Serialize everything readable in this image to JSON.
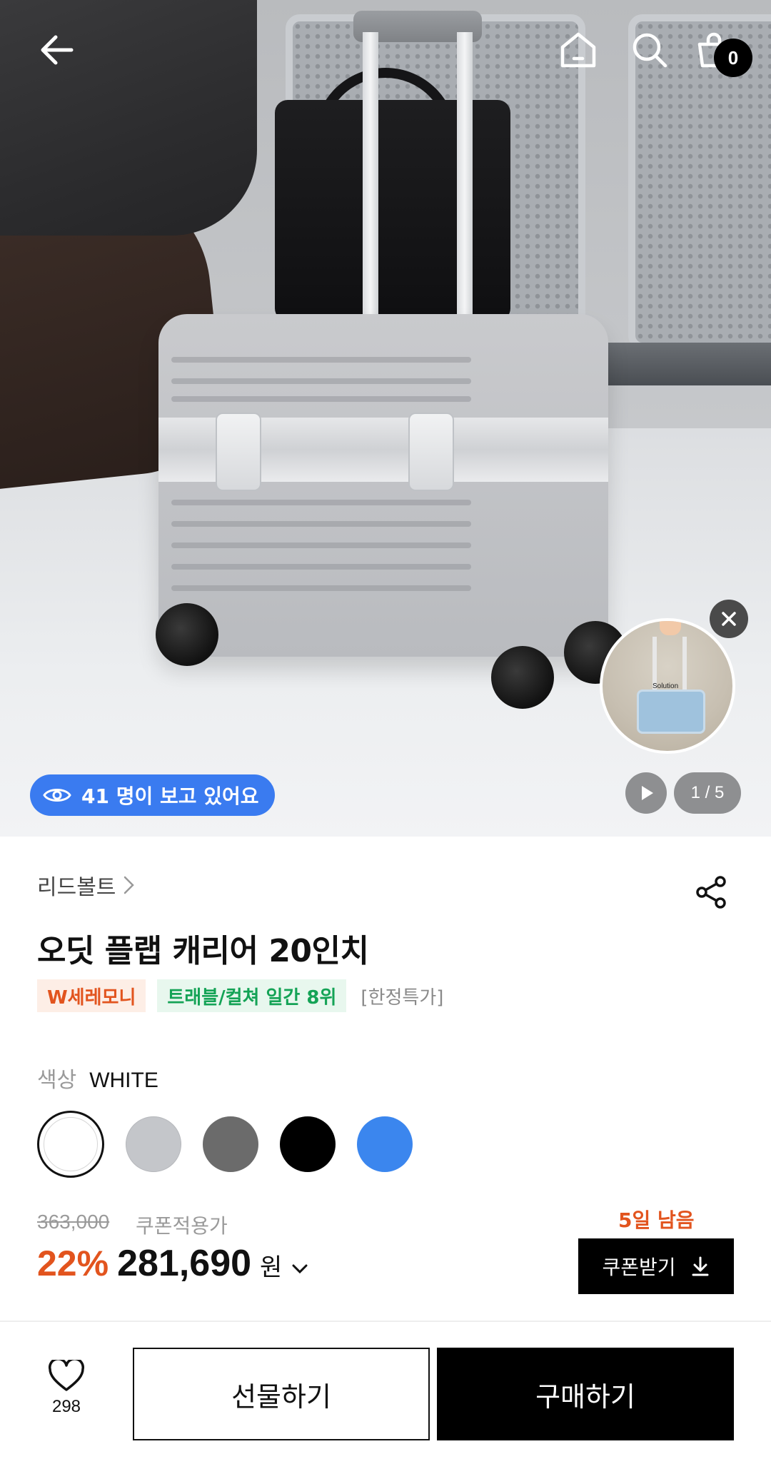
{
  "header": {
    "cart_count": "0",
    "icons": [
      "back-arrow-icon",
      "home-icon",
      "search-icon",
      "cart-icon"
    ]
  },
  "hero": {
    "viewers_text": "41 명이 보고 있어요",
    "page_indicator": "1 / 5",
    "video_thumb_text": "Solution"
  },
  "product": {
    "brand": "리드볼트",
    "title": "오딧 플랩 캐리어 20인치",
    "tags": {
      "tag1": "W세레모니",
      "tag2": "트래블/컬쳐 일간 8위",
      "tag3": "[한정특가]"
    },
    "color": {
      "label": "색상",
      "selected": "WHITE",
      "swatches": [
        "#ffffff",
        "#c4c6ca",
        "#6b6b6b",
        "#000000",
        "#3b86ee"
      ]
    },
    "price": {
      "original": "363,000",
      "coupon_note": "쿠폰적용가",
      "discount": "22%",
      "final": "281,690",
      "currency": "원",
      "days_left": "5일 남음",
      "coupon_button": "쿠폰받기"
    }
  },
  "bottom_bar": {
    "like_count": "298",
    "gift_label": "선물하기",
    "buy_label": "구매하기"
  },
  "colors": {
    "accent_orange": "#e2541e",
    "accent_green": "#14a356",
    "accent_blue": "#3a7bf0",
    "black": "#000000"
  }
}
